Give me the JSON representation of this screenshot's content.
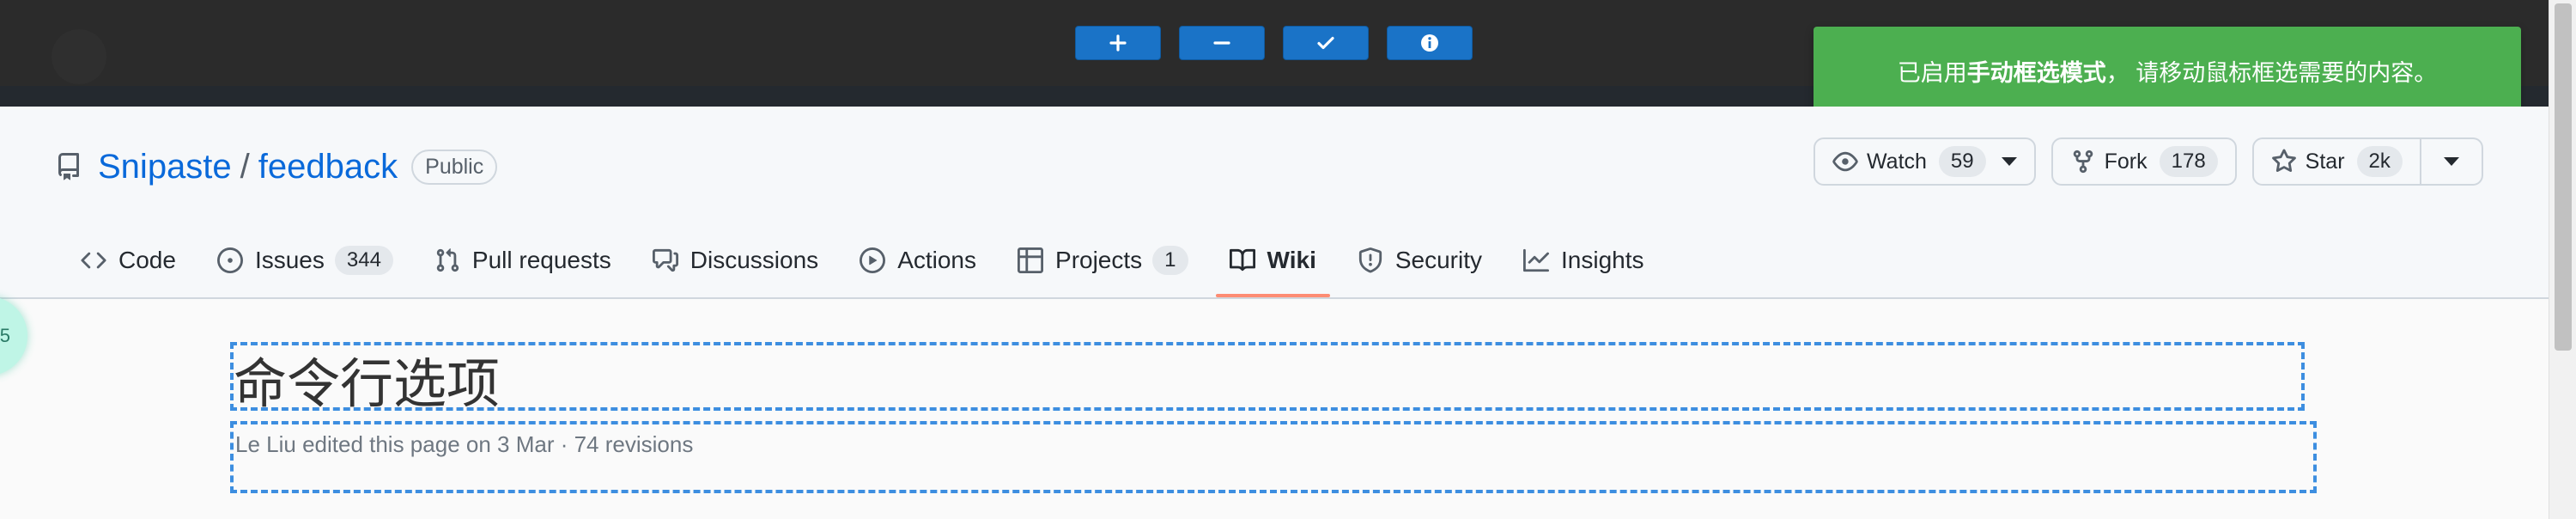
{
  "snip_toolbar": {
    "buttons": [
      {
        "name": "plus",
        "icon": "plus-icon"
      },
      {
        "name": "minus",
        "icon": "minus-icon"
      },
      {
        "name": "confirm",
        "icon": "check-icon"
      },
      {
        "name": "info",
        "icon": "info-icon"
      }
    ],
    "color": "#1a73c7"
  },
  "notification": {
    "prefix": "已启用 ",
    "emphasis": "手动框选模式",
    "suffix": "， 请移动鼠标框选需要的内容。",
    "color": "#4caf50"
  },
  "repo": {
    "owner": "Snipaste",
    "separator": "/",
    "name": "feedback",
    "visibility": "Public"
  },
  "actions": {
    "watch": {
      "label": "Watch",
      "count": "59"
    },
    "fork": {
      "label": "Fork",
      "count": "178"
    },
    "star": {
      "label": "Star",
      "count": "2k"
    }
  },
  "nav": {
    "code": "Code",
    "issues": "Issues",
    "issues_count": "344",
    "pulls": "Pull requests",
    "discussions": "Discussions",
    "actions": "Actions",
    "projects": "Projects",
    "projects_count": "1",
    "wiki": "Wiki",
    "security": "Security",
    "insights": "Insights",
    "selected": "Wiki",
    "underline_color": "#fd8c73"
  },
  "page": {
    "title": "命令行选项",
    "meta": "Le Liu edited this page on 3 Mar · 74 revisions",
    "bubble_text": "5"
  }
}
